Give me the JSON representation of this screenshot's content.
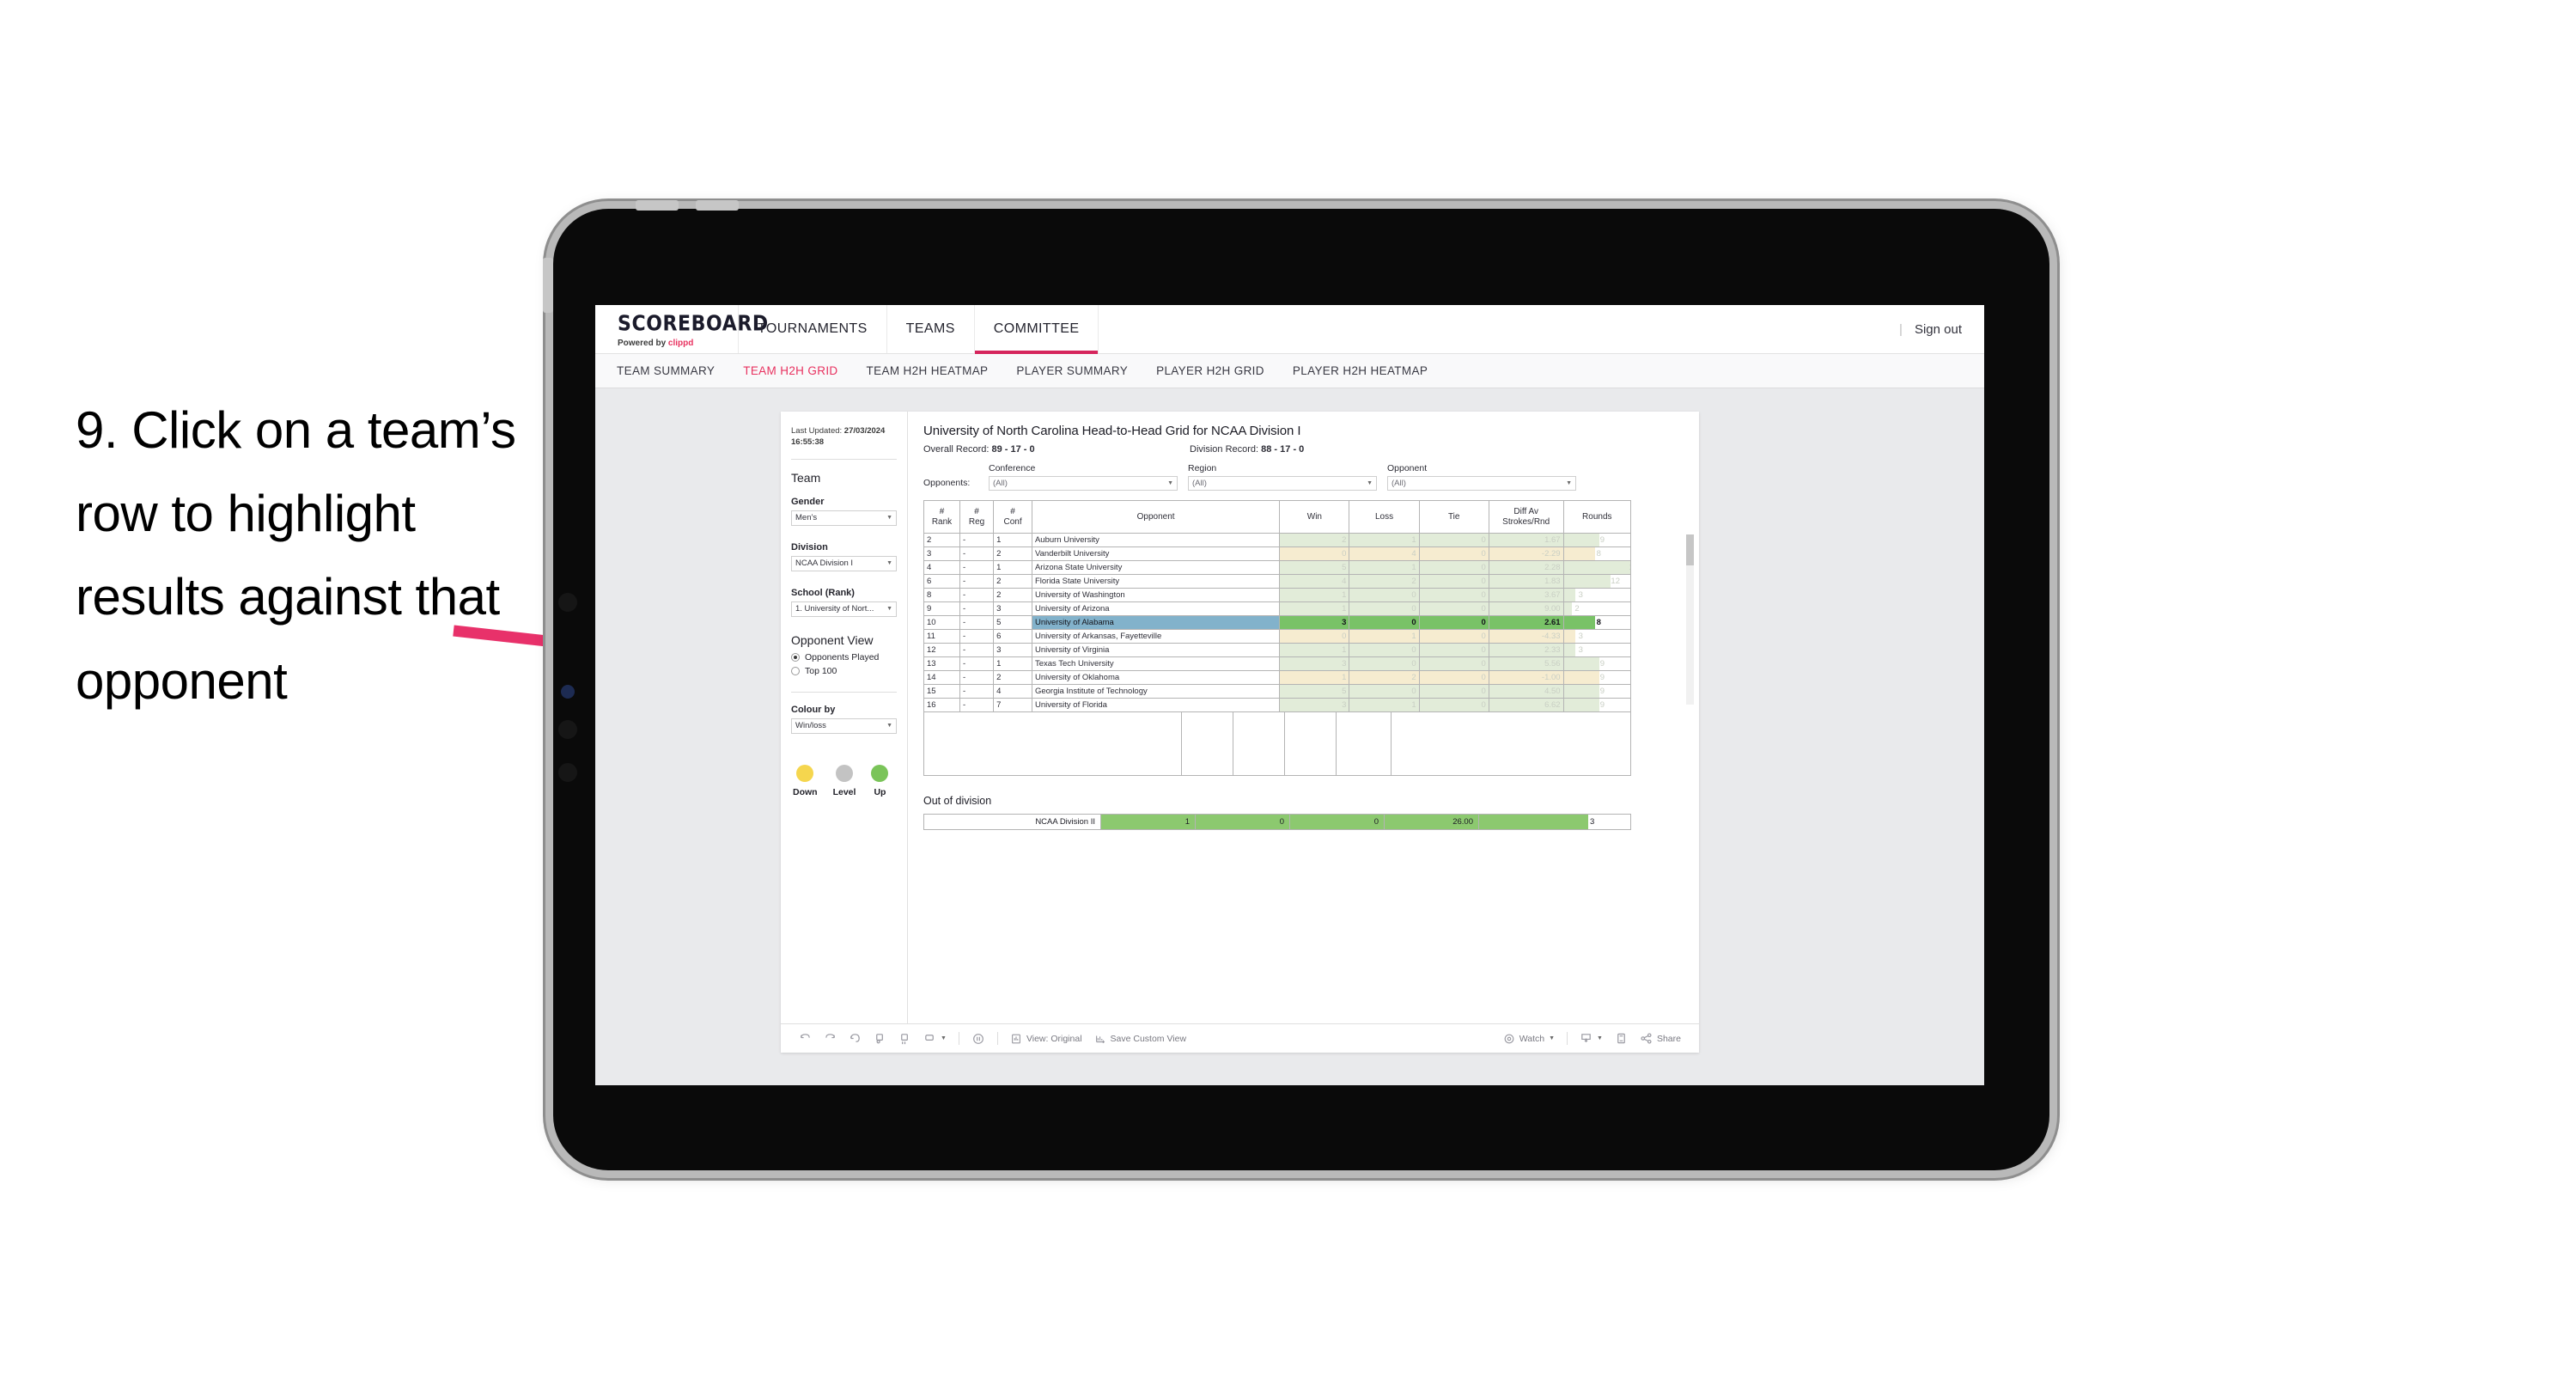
{
  "annotation": {
    "text": "9. Click on a team’s row to highlight results against that opponent",
    "arrow_color": "#e8316a"
  },
  "topnav": {
    "brand": "SCOREBOARD",
    "brand_sub_prefix": "Powered by ",
    "brand_sub_name": "clippd",
    "items": [
      {
        "label": "TOURNAMENTS",
        "active": false
      },
      {
        "label": "TEAMS",
        "active": false
      },
      {
        "label": "COMMITTEE",
        "active": true
      }
    ],
    "divider": "|",
    "sign_out": "Sign out",
    "accent": "#d5255c"
  },
  "subnav": {
    "items": [
      {
        "label": "TEAM SUMMARY",
        "active": false
      },
      {
        "label": "TEAM H2H GRID",
        "active": true
      },
      {
        "label": "TEAM H2H HEATMAP",
        "active": false
      },
      {
        "label": "PLAYER SUMMARY",
        "active": false
      },
      {
        "label": "PLAYER H2H GRID",
        "active": false
      },
      {
        "label": "PLAYER H2H HEATMAP",
        "active": false
      }
    ]
  },
  "sidebar": {
    "last_updated_label": "Last Updated: ",
    "last_updated_value": "27/03/2024 16:55:38",
    "team_heading": "Team",
    "gender_label": "Gender",
    "gender_value": "Men’s",
    "division_label": "Division",
    "division_value": "NCAA Division I",
    "school_label": "School (Rank)",
    "school_value": "1. University of Nort...",
    "opponent_view_heading": "Opponent View",
    "opponent_view_options": [
      {
        "label": "Opponents Played",
        "selected": true
      },
      {
        "label": "Top 100",
        "selected": false
      }
    ],
    "colour_by_label": "Colour by",
    "colour_by_value": "Win/loss",
    "legend": [
      {
        "label": "Down",
        "color": "#f5d64e"
      },
      {
        "label": "Level",
        "color": "#c3c3c3"
      },
      {
        "label": "Up",
        "color": "#7ac459"
      }
    ]
  },
  "viz": {
    "title": "University of North Carolina Head-to-Head Grid for NCAA Division I",
    "overall_record_label": "Overall Record: ",
    "overall_record_value": "89 - 17 - 0",
    "division_record_label": "Division Record: ",
    "division_record_value": "88 - 17 - 0",
    "opponents_label": "Opponents:",
    "filters": [
      {
        "label": "Conference",
        "value": "(All)"
      },
      {
        "label": "Region",
        "value": "(All)"
      },
      {
        "label": "Opponent",
        "value": "(All)"
      }
    ],
    "out_of_division_heading": "Out of division"
  },
  "chart_data": {
    "type": "table",
    "title": "University of North Carolina Head-to-Head Grid for NCAA Division I",
    "columns": [
      "# Rank",
      "# Reg",
      "# Conf",
      "Opponent",
      "Win",
      "Loss",
      "Tie",
      "Diff Av Strokes/Rnd",
      "Rounds"
    ],
    "rounds_axis_max": 17,
    "rows": [
      {
        "rank": "2",
        "reg": "-",
        "conf": "1",
        "opponent": "Auburn University",
        "win": "2",
        "loss": "1",
        "tie": "0",
        "diff": "1.67",
        "rounds": "9",
        "rounds_num": 9,
        "tint": "#e2ecd9",
        "selected": false
      },
      {
        "rank": "3",
        "reg": "-",
        "conf": "2",
        "opponent": "Vanderbilt University",
        "win": "0",
        "loss": "4",
        "tie": "0",
        "diff": "-2.29",
        "rounds": "8",
        "rounds_num": 8,
        "tint": "#f6ecd0",
        "selected": false
      },
      {
        "rank": "4",
        "reg": "-",
        "conf": "1",
        "opponent": "Arizona State University",
        "win": "5",
        "loss": "1",
        "tie": "0",
        "diff": "2.28",
        "rounds": "17",
        "rounds_num": 17,
        "tint": "#e2ecd9",
        "selected": false
      },
      {
        "rank": "6",
        "reg": "-",
        "conf": "2",
        "opponent": "Florida State University",
        "win": "4",
        "loss": "2",
        "tie": "0",
        "diff": "1.83",
        "rounds": "12",
        "rounds_num": 12,
        "tint": "#e2ecd9",
        "selected": false
      },
      {
        "rank": "8",
        "reg": "-",
        "conf": "2",
        "opponent": "University of Washington",
        "win": "1",
        "loss": "0",
        "tie": "0",
        "diff": "3.67",
        "rounds": "3",
        "rounds_num": 3,
        "tint": "#e2ecd9",
        "selected": false
      },
      {
        "rank": "9",
        "reg": "-",
        "conf": "3",
        "opponent": "University of Arizona",
        "win": "1",
        "loss": "0",
        "tie": "0",
        "diff": "9.00",
        "rounds": "2",
        "rounds_num": 2,
        "tint": "#e2ecd9",
        "selected": false
      },
      {
        "rank": "10",
        "reg": "-",
        "conf": "5",
        "opponent": "University of Alabama",
        "win": "3",
        "loss": "0",
        "tie": "0",
        "diff": "2.61",
        "rounds": "8",
        "rounds_num": 8,
        "tint": "#79c267",
        "selected": true
      },
      {
        "rank": "11",
        "reg": "-",
        "conf": "6",
        "opponent": "University of Arkansas, Fayetteville",
        "win": "0",
        "loss": "1",
        "tie": "0",
        "diff": "-4.33",
        "rounds": "3",
        "rounds_num": 3,
        "tint": "#f6ecd0",
        "selected": false
      },
      {
        "rank": "12",
        "reg": "-",
        "conf": "3",
        "opponent": "University of Virginia",
        "win": "1",
        "loss": "0",
        "tie": "0",
        "diff": "2.33",
        "rounds": "3",
        "rounds_num": 3,
        "tint": "#e2ecd9",
        "selected": false
      },
      {
        "rank": "13",
        "reg": "-",
        "conf": "1",
        "opponent": "Texas Tech University",
        "win": "3",
        "loss": "0",
        "tie": "0",
        "diff": "5.56",
        "rounds": "9",
        "rounds_num": 9,
        "tint": "#e2ecd9",
        "selected": false
      },
      {
        "rank": "14",
        "reg": "-",
        "conf": "2",
        "opponent": "University of Oklahoma",
        "win": "1",
        "loss": "2",
        "tie": "0",
        "diff": "-1.00",
        "rounds": "9",
        "rounds_num": 9,
        "tint": "#f6ecd0",
        "selected": false
      },
      {
        "rank": "15",
        "reg": "-",
        "conf": "4",
        "opponent": "Georgia Institute of Technology",
        "win": "5",
        "loss": "0",
        "tie": "0",
        "diff": "4.50",
        "rounds": "9",
        "rounds_num": 9,
        "tint": "#e2ecd9",
        "selected": false
      },
      {
        "rank": "16",
        "reg": "-",
        "conf": "7",
        "opponent": "University of Florida",
        "win": "3",
        "loss": "1",
        "tie": "0",
        "diff": "6.62",
        "rounds": "9",
        "rounds_num": 9,
        "tint": "#e2ecd9",
        "selected": false
      }
    ],
    "out_of_division": {
      "name": "NCAA Division II",
      "win": "1",
      "loss": "0",
      "tie": "0",
      "diff": "26.00",
      "rounds": "3",
      "rounds_num": 3,
      "color": "#8cc96f"
    }
  },
  "toolbar": {
    "items": [
      {
        "name": "undo",
        "label": ""
      },
      {
        "name": "redo",
        "label": ""
      },
      {
        "name": "revert",
        "label": ""
      },
      {
        "name": "refresh",
        "label": ""
      },
      {
        "name": "pause",
        "label": ""
      },
      {
        "name": "device-layout",
        "label": ""
      }
    ],
    "view_label": "View: Original",
    "save_custom_view_label": "Save Custom View",
    "watch_label": "Watch",
    "share_label": "Share"
  }
}
